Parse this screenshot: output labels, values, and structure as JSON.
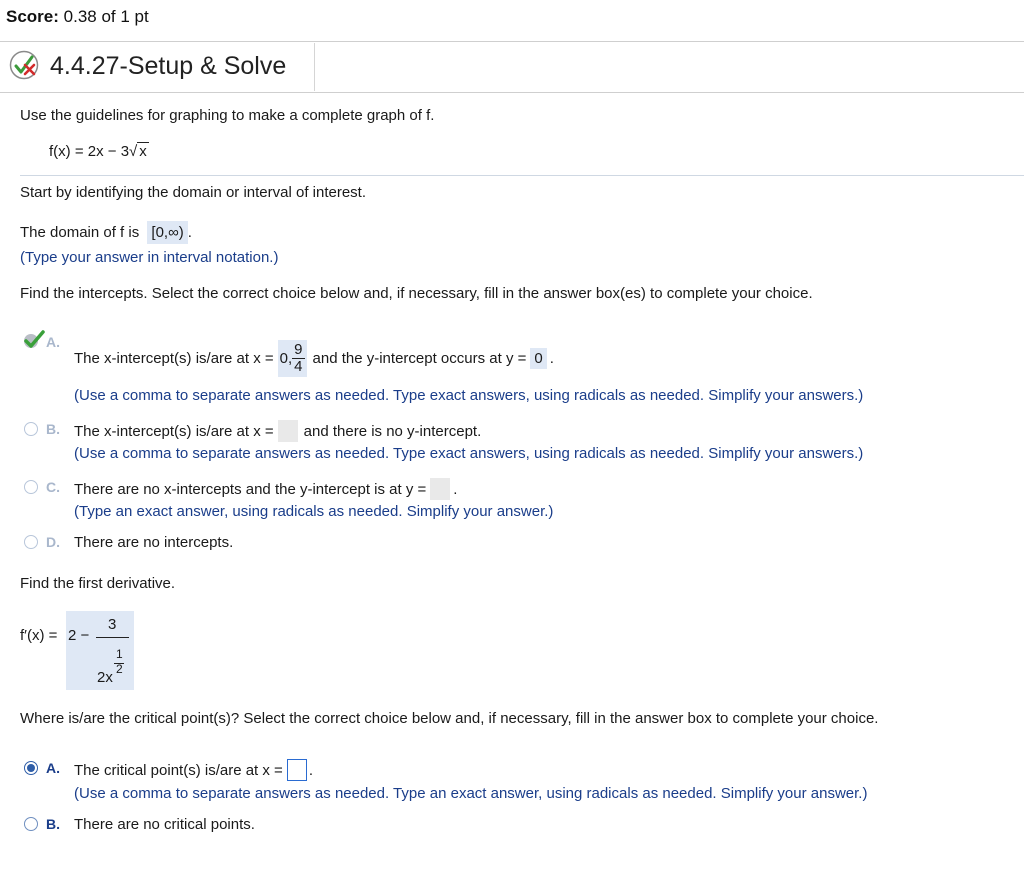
{
  "header": {
    "score_label": "Score:",
    "score_value": "0.38 of 1 pt",
    "question_id": "4.4.27-Setup & Solve",
    "status_icon": "partial-credit-pencil-x-icon"
  },
  "problem": {
    "instruction": "Use the guidelines for graphing to make a complete graph of f.",
    "function_prefix": "f(x) = 2x − 3",
    "function_radicand": "x"
  },
  "step_domain": {
    "intro": "Start by identifying the domain or interval of interest.",
    "prompt": "The domain of f is",
    "answer": "[0,∞)",
    "suffix": ".",
    "hint": "(Type your answer in interval notation.)"
  },
  "step_intercepts": {
    "prompt": "Find the intercepts. Select the correct choice below and, if necessary, fill in the answer box(es) to complete your choice.",
    "choice_a": {
      "letter": "A.",
      "text_before": "The x-intercept(s) is/are at x =",
      "answer_x_prefix": "0,",
      "answer_x_num": "9",
      "answer_x_den": "4",
      "text_middle": "and the y-intercept occurs at y =",
      "answer_y": "0",
      "suffix": ".",
      "hint": "(Use a comma to separate answers as needed. Type exact answers, using radicals as needed. Simplify your answers.)",
      "status_icon": "correct-checkmark-icon"
    },
    "choice_b": {
      "letter": "B.",
      "text_before": "The x-intercept(s) is/are at x =",
      "text_after": "and there is no y-intercept.",
      "hint": "(Use a comma to separate answers as needed. Type exact answers, using radicals as needed. Simplify your answers.)"
    },
    "choice_c": {
      "letter": "C.",
      "text_before": "There are no x-intercepts and the y-intercept is at y =",
      "suffix": ".",
      "hint": "(Type an exact answer, using radicals as needed. Simplify your answer.)"
    },
    "choice_d": {
      "letter": "D.",
      "text": "There are no intercepts."
    }
  },
  "step_derivative": {
    "prompt": "Find the first derivative.",
    "label": "f′(x) =",
    "answer_lead": "2 −",
    "answer_num": "3",
    "answer_base": "2x",
    "exp_num": "1",
    "exp_den": "2"
  },
  "step_critical": {
    "prompt": "Where is/are the critical point(s)? Select the correct choice below and, if necessary, fill in the answer box to complete your choice.",
    "choice_a": {
      "letter": "A.",
      "text_before": "The critical point(s) is/are at x =",
      "suffix": ".",
      "hint": "(Use a comma to separate answers as needed. Type an exact answer, using radicals as needed. Simplify your answer.)"
    },
    "choice_b": {
      "letter": "B.",
      "text": "There are no critical points."
    }
  }
}
